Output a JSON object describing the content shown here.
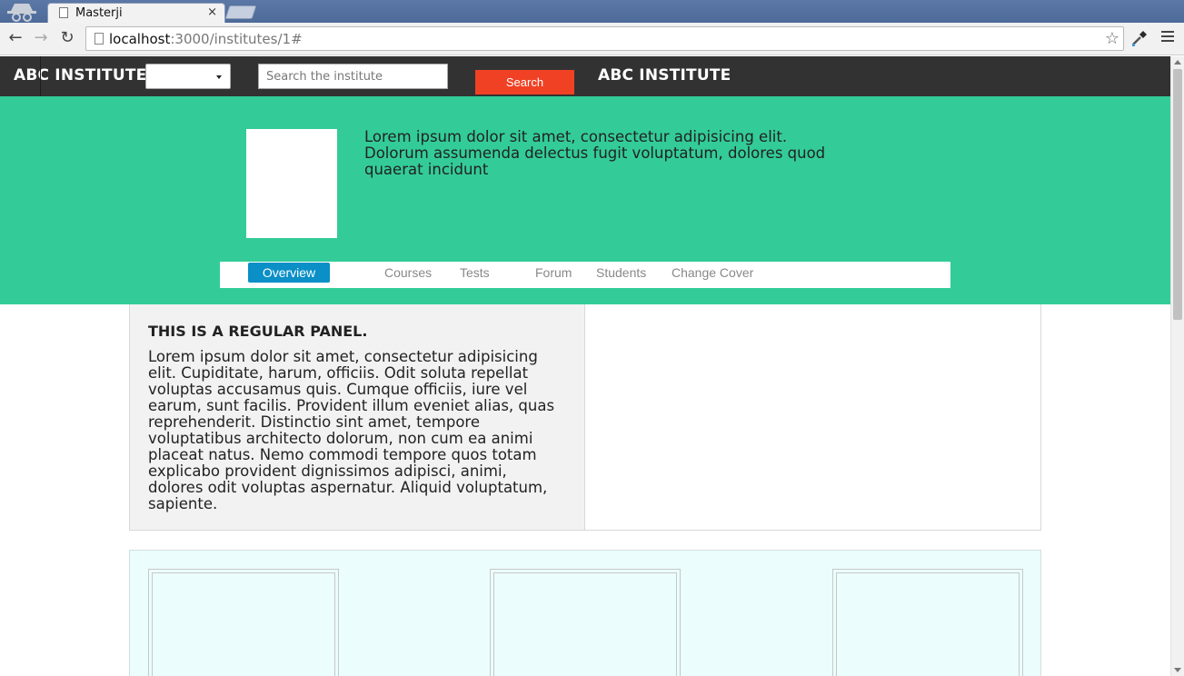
{
  "browser": {
    "tab_title": "Masterji",
    "tab_close": "×",
    "url_host": "localhost",
    "url_rest": ":3000/institutes/1#"
  },
  "navbar": {
    "brand_left": "ABC INSTITUTE",
    "brand_right": "ABC INSTITUTE",
    "select_value": "",
    "search_placeholder": "Search the institute",
    "search_button": "Search"
  },
  "hero": {
    "description": "Lorem ipsum dolor sit amet, consectetur adipisicing elit. Dolorum assumenda delectus fugit voluptatum, dolores quod quaerat incidunt",
    "tabs": [
      {
        "label": "Overview",
        "active": true
      },
      {
        "label": "Courses",
        "active": false
      },
      {
        "label": "Tests",
        "active": false
      },
      {
        "label": "Forum",
        "active": false
      },
      {
        "label": "Students",
        "active": false
      },
      {
        "label": "Change Cover",
        "active": false
      }
    ]
  },
  "panel": {
    "title": "THIS IS A REGULAR PANEL.",
    "body": "Lorem ipsum dolor sit amet, consectetur adipisicing elit. Cupiditate, harum, officiis. Odit soluta repellat voluptas accusamus quis. Cumque officiis, iure vel earum, sunt facilis. Provident illum eveniet alias, quas reprehenderit. Distinctio sint amet, tempore voluptatibus architecto dolorum, non cum ea animi placeat natus. Nemo commodi tempore quos totam explicabo provident dignissimos adipisci, animi, dolores odit voluptas aspernatur. Aliquid voluptatum, sapiente."
  },
  "colors": {
    "navbar_bg": "#323232",
    "hero_bg": "#33cc98",
    "search_button_bg": "#f04124",
    "active_tab_bg": "#0a8fc7",
    "cards_bg": "#ebfdfd"
  }
}
